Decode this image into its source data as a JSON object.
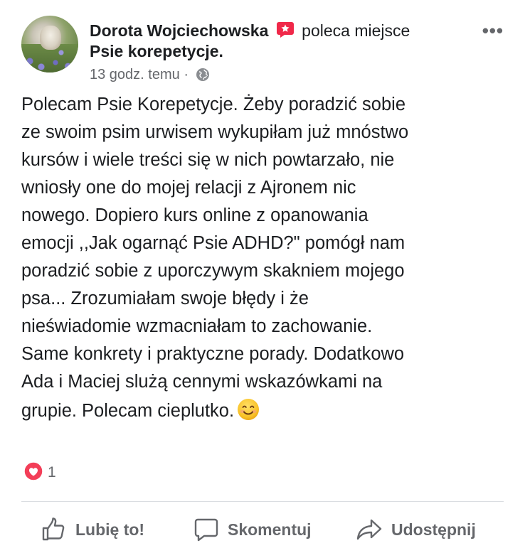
{
  "post": {
    "author": "Dorota Wojciechowska",
    "recommends_text": "poleca miejsce",
    "page_name": "Psie korepetycje.",
    "time": "13 godz. temu",
    "separator": "·",
    "body_lines": [
      "Polecam Psie Korepetycje. Żeby poradzić sobie",
      "ze swoim psim urwisem wykupiłam już mnóstwo",
      "kursów i wiele treści się w nich powtarzało, nie",
      "wniosły one do mojej relacji z Ajronem nic",
      "nowego. Dopiero kurs online z opanowania",
      "emocji ,,Jak ogarnąć Psie ADHD?\" pomógł nam",
      "poradzić sobie z uporczywym skakniem mojego",
      "psa... Zrozumiałam swoje błędy i że",
      "nieświadomie wzmacniałam to zachowanie.",
      "Same konkrety i praktyczne porady. Dodatkowo",
      "Ada i Maciej slużą cennymi wskazówkami na",
      "grupie. Polecam cieplutko."
    ],
    "reaction_count": "1",
    "icons": {
      "recommend": "recommend-icon",
      "privacy": "globe-icon",
      "reaction": "heart-reaction-icon",
      "emoji": "smiling-face-emoji",
      "more": "more-options-icon"
    }
  },
  "actions": {
    "like": "Lubię to!",
    "comment": "Skomentuj",
    "share": "Udostępnij"
  },
  "colors": {
    "text": "#1c1e21",
    "secondary": "#65676b",
    "recommend_red": "#f02849",
    "heart_red": "#f33e58",
    "divider": "#dadde1"
  }
}
